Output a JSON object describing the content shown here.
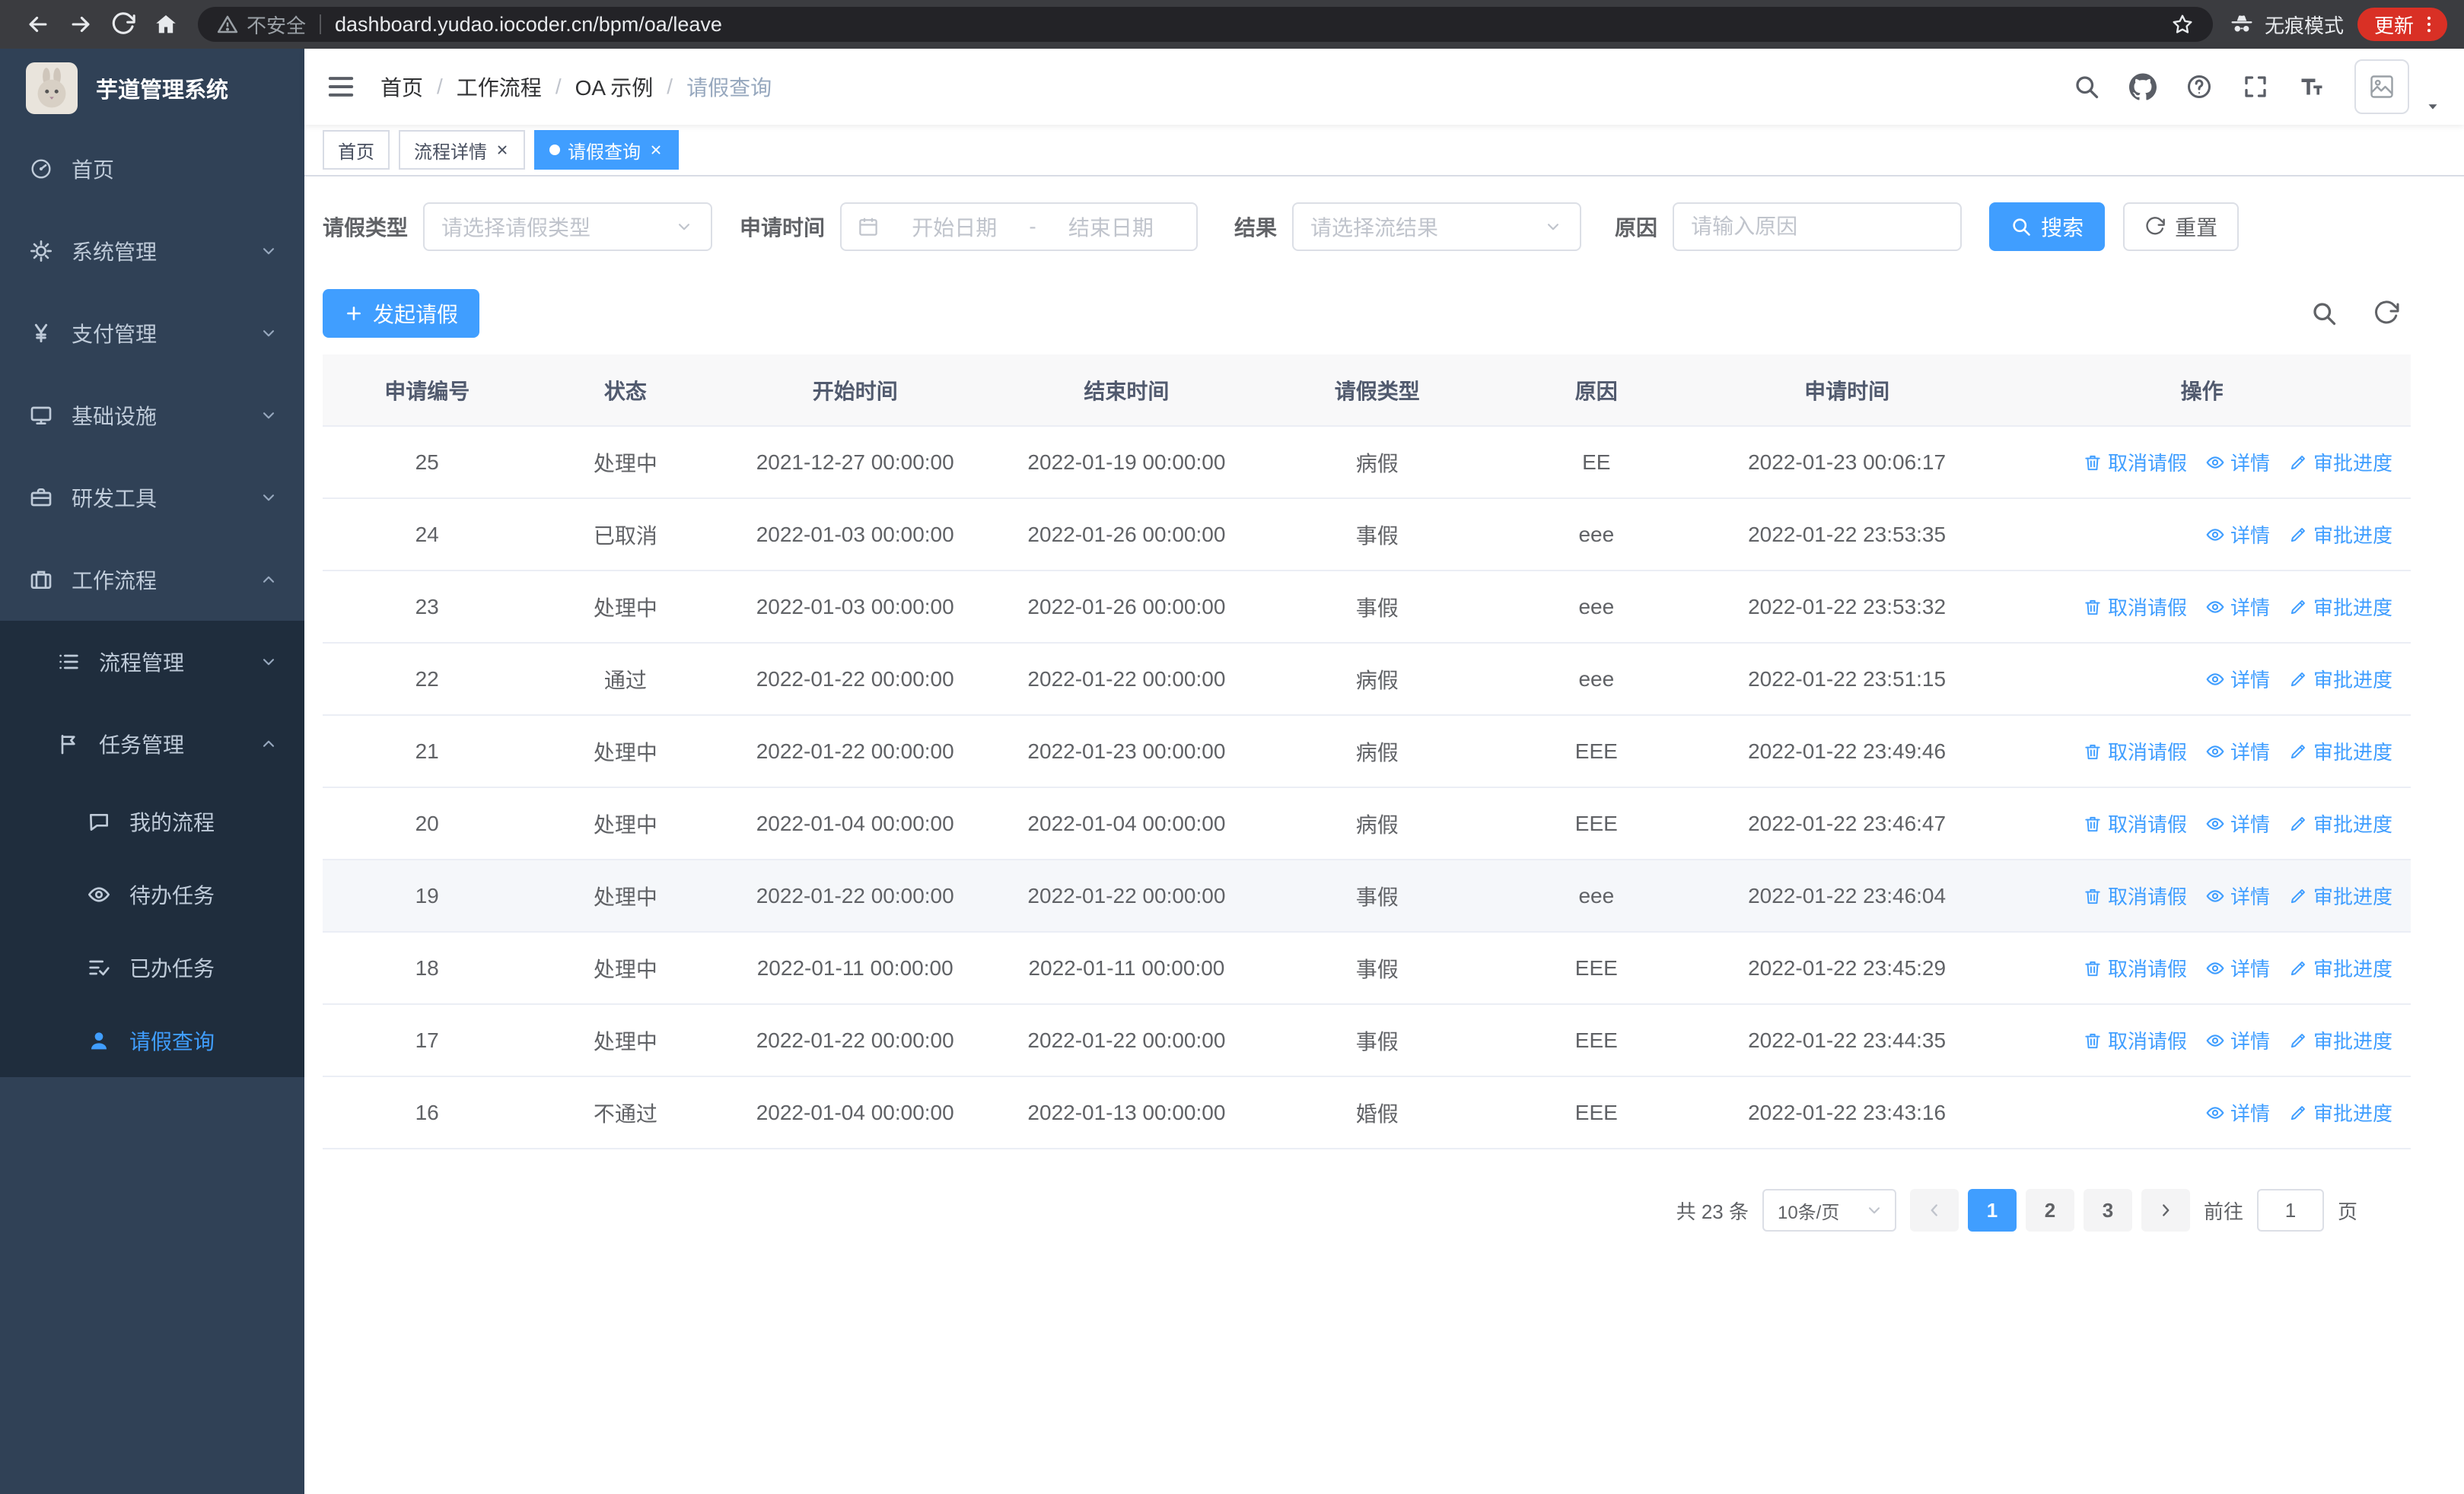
{
  "colors": {
    "primary": "#409eff",
    "sidebar_bg": "#304156",
    "sidebar_sub_bg": "#1f2d3d",
    "update_pill": "#d93025"
  },
  "browser": {
    "security_label": "不安全",
    "url": "dashboard.yudao.iocoder.cn/bpm/oa/leave",
    "incognito_label": "无痕模式",
    "update_label": "更新"
  },
  "sidebar": {
    "app_title": "芋道管理系统",
    "menu": [
      {
        "key": "home",
        "label": "首页",
        "icon": "dashboard-icon",
        "level": 0
      },
      {
        "key": "system",
        "label": "系统管理",
        "icon": "gear-icon",
        "level": 0,
        "chevron": "down"
      },
      {
        "key": "payment",
        "label": "支付管理",
        "icon": "yen-icon",
        "level": 0,
        "chevron": "down"
      },
      {
        "key": "infrastructure",
        "label": "基础设施",
        "icon": "monitor-icon",
        "level": 0,
        "chevron": "down"
      },
      {
        "key": "dev-tools",
        "label": "研发工具",
        "icon": "toolbox-icon",
        "level": 0,
        "chevron": "down"
      },
      {
        "key": "workflow",
        "label": "工作流程",
        "icon": "suitcase-icon",
        "level": 0,
        "chevron": "up"
      },
      {
        "key": "process-management",
        "label": "流程管理",
        "icon": "list-icon",
        "level": 1,
        "chevron": "down"
      },
      {
        "key": "task-management",
        "label": "任务管理",
        "icon": "flag-icon",
        "level": 1,
        "chevron": "up"
      },
      {
        "key": "my-process",
        "label": "我的流程",
        "icon": "chat-icon",
        "level": 2
      },
      {
        "key": "todo-tasks",
        "label": "待办任务",
        "icon": "eye-icon",
        "level": 2
      },
      {
        "key": "done-tasks",
        "label": "已办任务",
        "icon": "finished-icon",
        "level": 2
      },
      {
        "key": "leave-query",
        "label": "请假查询",
        "icon": "user-icon",
        "level": 2,
        "active": true
      }
    ]
  },
  "header": {
    "breadcrumb": [
      "首页",
      "工作流程",
      "OA 示例",
      "请假查询"
    ],
    "breadcrumb_separator": "/"
  },
  "tabs": [
    {
      "key": "home",
      "label": "首页"
    },
    {
      "key": "process-detail",
      "label": "流程详情",
      "closable": true
    },
    {
      "key": "leave-query",
      "label": "请假查询",
      "closable": true,
      "active": true
    }
  ],
  "filters": {
    "leave_type": {
      "label": "请假类型",
      "placeholder": "请选择请假类型"
    },
    "apply_time": {
      "label": "申请时间",
      "start_placeholder": "开始日期",
      "separator": "-",
      "end_placeholder": "结束日期"
    },
    "result": {
      "label": "结果",
      "placeholder": "请选择流结果"
    },
    "reason": {
      "label": "原因",
      "placeholder": "请输入原因"
    },
    "search_label": "搜索",
    "reset_label": "重置"
  },
  "toolbar": {
    "create_label": "发起请假"
  },
  "table": {
    "columns": [
      "申请编号",
      "状态",
      "开始时间",
      "结束时间",
      "请假类型",
      "原因",
      "申请时间",
      "操作"
    ],
    "action_labels": {
      "cancel": "取消请假",
      "detail": "详情",
      "progress": "审批进度"
    },
    "rows": [
      {
        "id": "25",
        "status": "处理中",
        "start": "2021-12-27 00:00:00",
        "end": "2022-01-19 00:00:00",
        "type": "病假",
        "reason": "EE",
        "applied": "2022-01-23 00:06:17",
        "actions": [
          "cancel",
          "detail",
          "progress"
        ]
      },
      {
        "id": "24",
        "status": "已取消",
        "start": "2022-01-03 00:00:00",
        "end": "2022-01-26 00:00:00",
        "type": "事假",
        "reason": "eee",
        "applied": "2022-01-22 23:53:35",
        "actions": [
          "detail",
          "progress"
        ]
      },
      {
        "id": "23",
        "status": "处理中",
        "start": "2022-01-03 00:00:00",
        "end": "2022-01-26 00:00:00",
        "type": "事假",
        "reason": "eee",
        "applied": "2022-01-22 23:53:32",
        "actions": [
          "cancel",
          "detail",
          "progress"
        ]
      },
      {
        "id": "22",
        "status": "通过",
        "start": "2022-01-22 00:00:00",
        "end": "2022-01-22 00:00:00",
        "type": "病假",
        "reason": "eee",
        "applied": "2022-01-22 23:51:15",
        "actions": [
          "detail",
          "progress"
        ]
      },
      {
        "id": "21",
        "status": "处理中",
        "start": "2022-01-22 00:00:00",
        "end": "2022-01-23 00:00:00",
        "type": "病假",
        "reason": "EEE",
        "applied": "2022-01-22 23:49:46",
        "actions": [
          "cancel",
          "detail",
          "progress"
        ]
      },
      {
        "id": "20",
        "status": "处理中",
        "start": "2022-01-04 00:00:00",
        "end": "2022-01-04 00:00:00",
        "type": "病假",
        "reason": "EEE",
        "applied": "2022-01-22 23:46:47",
        "actions": [
          "cancel",
          "detail",
          "progress"
        ]
      },
      {
        "id": "19",
        "status": "处理中",
        "start": "2022-01-22 00:00:00",
        "end": "2022-01-22 00:00:00",
        "type": "事假",
        "reason": "eee",
        "applied": "2022-01-22 23:46:04",
        "actions": [
          "cancel",
          "detail",
          "progress"
        ],
        "highlighted": true
      },
      {
        "id": "18",
        "status": "处理中",
        "start": "2022-01-11 00:00:00",
        "end": "2022-01-11 00:00:00",
        "type": "事假",
        "reason": "EEE",
        "applied": "2022-01-22 23:45:29",
        "actions": [
          "cancel",
          "detail",
          "progress"
        ]
      },
      {
        "id": "17",
        "status": "处理中",
        "start": "2022-01-22 00:00:00",
        "end": "2022-01-22 00:00:00",
        "type": "事假",
        "reason": "EEE",
        "applied": "2022-01-22 23:44:35",
        "actions": [
          "cancel",
          "detail",
          "progress"
        ]
      },
      {
        "id": "16",
        "status": "不通过",
        "start": "2022-01-04 00:00:00",
        "end": "2022-01-13 00:00:00",
        "type": "婚假",
        "reason": "EEE",
        "applied": "2022-01-22 23:43:16",
        "actions": [
          "detail",
          "progress"
        ]
      }
    ]
  },
  "pagination": {
    "total_label": "共 23 条",
    "page_size_label": "10条/页",
    "pages": [
      "1",
      "2",
      "3"
    ],
    "active_page": "1",
    "goto_label": "前往",
    "goto_value": "1",
    "goto_suffix": "页"
  }
}
